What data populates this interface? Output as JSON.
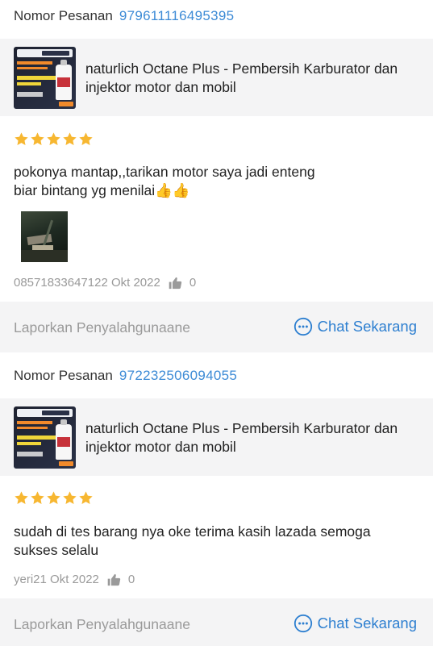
{
  "reviews": [
    {
      "order_label": "Nomor Pesanan",
      "order_number": "979611116495395",
      "product_name": "naturlich Octane Plus - Pembersih Karburator dan injektor  motor dan mobil",
      "rating": 5,
      "text": "pokonya mantap,,tarikan motor saya jadi enteng\nbiar bintang yg menilai👍👍",
      "has_photo": true,
      "author_date": "08571833647122 Okt 2022",
      "likes": "0",
      "report_label": "Laporkan Penyalahgunaane",
      "chat_label": "Chat Sekarang"
    },
    {
      "order_label": "Nomor Pesanan",
      "order_number": "972232506094055",
      "product_name": "naturlich Octane Plus - Pembersih Karburator dan injektor  motor dan mobil",
      "rating": 5,
      "text": "sudah di tes barang nya oke terima kasih lazada semoga sukses selalu",
      "has_photo": false,
      "author_date": "yeri21 Okt 2022",
      "likes": "0",
      "report_label": "Laporkan Penyalahgunaane",
      "chat_label": "Chat Sekarang"
    }
  ],
  "icons": {
    "star": "star-icon",
    "like": "thumbs-up-icon",
    "chat": "chat-bubble-icon"
  },
  "colors": {
    "accent": "#3d8bd6",
    "star": "#f7b731",
    "muted": "#9a9a9a",
    "card_bg": "#f4f4f5"
  }
}
